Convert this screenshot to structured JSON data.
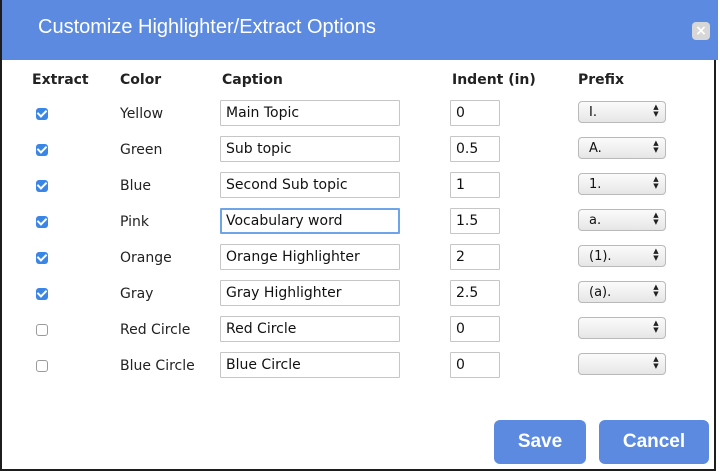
{
  "dialog": {
    "title": "Customize Highlighter/Extract Options",
    "close_label": "×"
  },
  "headers": {
    "extract": "Extract",
    "color": "Color",
    "caption": "Caption",
    "indent": "Indent (in)",
    "prefix": "Prefix"
  },
  "rows": [
    {
      "checked": true,
      "color": "Yellow",
      "caption": "Main Topic",
      "indent": "0",
      "prefix": "I."
    },
    {
      "checked": true,
      "color": "Green",
      "caption": "Sub topic",
      "indent": "0.5",
      "prefix": "A."
    },
    {
      "checked": true,
      "color": "Blue",
      "caption": "Second Sub topic",
      "indent": "1",
      "prefix": "1."
    },
    {
      "checked": true,
      "color": "Pink",
      "caption": "Vocabulary word",
      "indent": "1.5",
      "prefix": "a."
    },
    {
      "checked": true,
      "color": "Orange",
      "caption": "Orange Highlighter",
      "indent": "2",
      "prefix": "(1)."
    },
    {
      "checked": true,
      "color": "Gray",
      "caption": "Gray Highlighter",
      "indent": "2.5",
      "prefix": "(a)."
    },
    {
      "checked": false,
      "color": "Red Circle",
      "caption": "Red Circle",
      "indent": "0",
      "prefix": ""
    },
    {
      "checked": false,
      "color": "Blue Circle",
      "caption": "Blue Circle",
      "indent": "0",
      "prefix": ""
    }
  ],
  "buttons": {
    "save": "Save",
    "cancel": "Cancel"
  },
  "theme": {
    "accent": "#5b8ae0",
    "checkbox": "#3a86e6",
    "focus_border": "#6fa3ea"
  }
}
